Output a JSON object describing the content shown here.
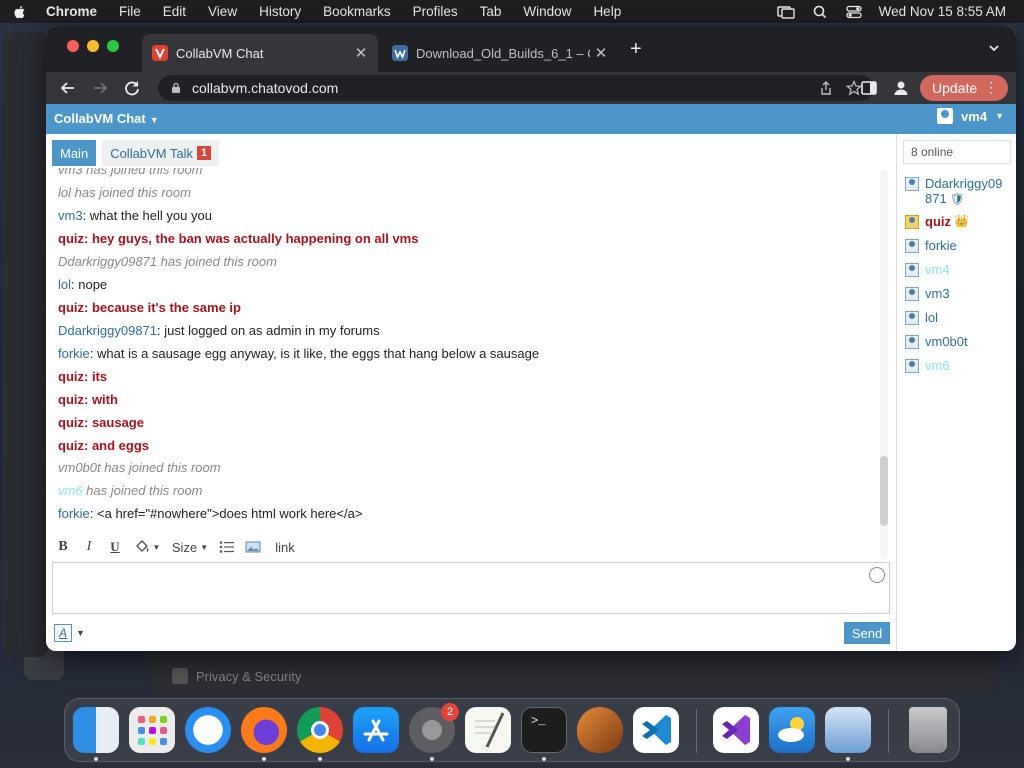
{
  "menubar": {
    "app": "Chrome",
    "items": [
      "File",
      "Edit",
      "View",
      "History",
      "Bookmarks",
      "Profiles",
      "Tab",
      "Window",
      "Help"
    ],
    "clock": "Wed Nov 15  8:55 AM"
  },
  "tabs": [
    {
      "title": "CollabVM Chat",
      "close": "✕"
    },
    {
      "title": "Download_Old_Builds_6_1 – C",
      "close": "✕"
    }
  ],
  "new_tab": "+",
  "address": {
    "url": "collabvm.chatovod.com"
  },
  "update_button": "Update",
  "chat": {
    "title": "CollabVM Chat",
    "current_user": "vm4",
    "channel_tabs": [
      {
        "label": "Main"
      },
      {
        "label": "CollabVM Talk",
        "badge": "1"
      }
    ],
    "messages": [
      {
        "type": "system",
        "user": "vm3",
        "text": " has joined this room"
      },
      {
        "type": "system",
        "user": "lol",
        "text": " has joined this room"
      },
      {
        "type": "chat",
        "user": "vm3",
        "text": ": what the hell you you"
      },
      {
        "type": "admin",
        "user": "quiz",
        "text": ": hey guys, the ban was actually happening on all vms"
      },
      {
        "type": "system",
        "user": "Ddarkriggy09871",
        "text": " has joined this room"
      },
      {
        "type": "chat",
        "user": "lol",
        "text": ": nope"
      },
      {
        "type": "admin",
        "user": "quiz",
        "text": ": because it's the same ip"
      },
      {
        "type": "chat",
        "user": "Ddarkriggy09871",
        "text": ": just logged on as admin in my forums"
      },
      {
        "type": "chat",
        "user": "forkie",
        "text": ": what is a sausage egg anyway, is it like, the eggs that hang below a sausage"
      },
      {
        "type": "admin",
        "user": "quiz",
        "text": ": its"
      },
      {
        "type": "admin",
        "user": "quiz",
        "text": ": with"
      },
      {
        "type": "admin",
        "user": "quiz",
        "text": ": sausage"
      },
      {
        "type": "admin",
        "user": "quiz",
        "text": ": and eggs"
      },
      {
        "type": "system",
        "user": "vm0b0t",
        "text": " has joined this room"
      },
      {
        "type": "system-faint",
        "user": "vm6",
        "text": " has joined this room"
      },
      {
        "type": "chat",
        "user": "forkie",
        "text": ": <a href=\"#nowhere\">does html work here</a>"
      }
    ],
    "editor": {
      "bold": "B",
      "italic": "I",
      "underline": "U",
      "size": "Size",
      "link": "link"
    },
    "format_button": "A",
    "send": "Send",
    "online_count": "8 online",
    "users": [
      {
        "name": "Ddarkriggy09871",
        "line1": "Ddarkriggy09",
        "line2": "871",
        "role": "moderator",
        "marker": "🛡"
      },
      {
        "name": "quiz",
        "role": "admin",
        "marker": "👑"
      },
      {
        "name": "forkie",
        "role": "user"
      },
      {
        "name": "vm4",
        "role": "faint"
      },
      {
        "name": "vm3",
        "role": "user"
      },
      {
        "name": "lol",
        "role": "user"
      },
      {
        "name": "vm0b0t",
        "role": "user"
      },
      {
        "name": "vm6",
        "role": "faint"
      }
    ]
  },
  "background": {
    "privacy_label": "Privacy & Security"
  },
  "dock": {
    "apps": [
      "Finder",
      "Launchpad",
      "Safari",
      "Firefox",
      "Chrome",
      "App Store",
      "System Settings",
      "TextEdit",
      "Terminal",
      "GarageBand",
      "Visual Studio Code",
      "Visual Studio",
      "Weather",
      "VirtualBox",
      "Trash"
    ],
    "settings_badge": "2"
  },
  "colors": {
    "accent": "#4d96c9",
    "admin": "#a3141f",
    "link": "#2f6e98",
    "faint": "#8fe3f0"
  }
}
